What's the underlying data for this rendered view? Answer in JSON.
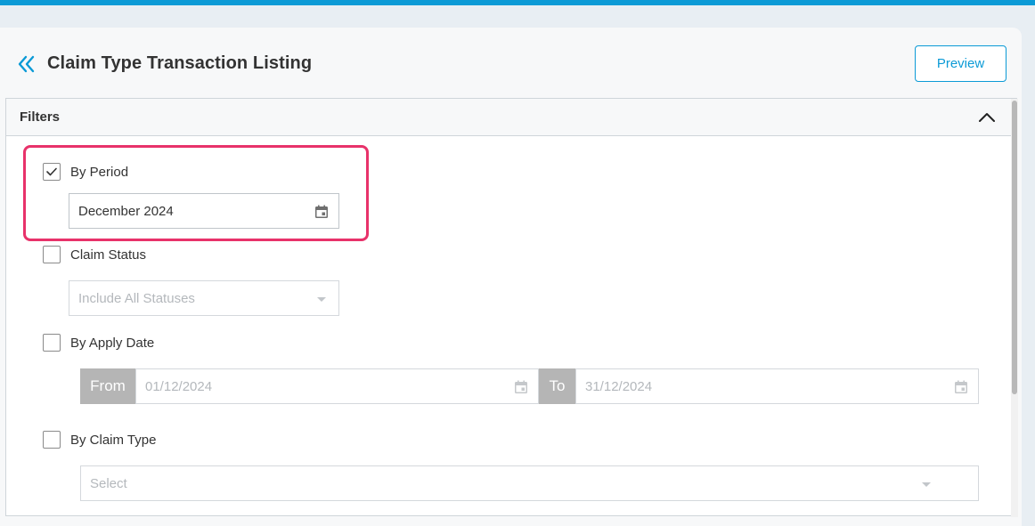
{
  "header": {
    "title": "Claim Type Transaction Listing",
    "preview_label": "Preview"
  },
  "filters": {
    "title": "Filters",
    "by_period": {
      "label": "By Period",
      "checked": true,
      "value": "December 2024"
    },
    "claim_status": {
      "label": "Claim Status",
      "checked": false,
      "placeholder": "Include All Statuses"
    },
    "by_apply_date": {
      "label": "By Apply Date",
      "checked": false,
      "from_label": "From",
      "from_value": "01/12/2024",
      "to_label": "To",
      "to_value": "31/12/2024"
    },
    "by_claim_type": {
      "label": "By Claim Type",
      "checked": false,
      "placeholder": "Select"
    }
  },
  "colors": {
    "accent": "#0b9ad6",
    "highlight": "#e8326a",
    "addon": "#b5b5b5"
  }
}
